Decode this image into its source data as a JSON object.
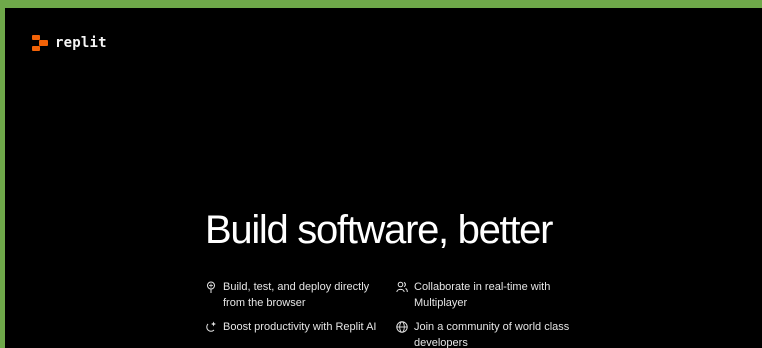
{
  "brand": {
    "name": "replit",
    "accent_color": "#f26207"
  },
  "hero": {
    "headline": "Build software, better"
  },
  "features": [
    {
      "icon": "balloon-icon",
      "text": "Build, test, and deploy directly from the browser"
    },
    {
      "icon": "users-icon",
      "text": "Collaborate in real-time with Multiplayer"
    },
    {
      "icon": "ai-sparkle-icon",
      "text": "Boost productivity with Replit AI"
    },
    {
      "icon": "globe-icon",
      "text": "Join a community of world class developers"
    }
  ],
  "colors": {
    "frame_border": "#6fa84a",
    "background": "#000000",
    "text": "#ffffff"
  }
}
